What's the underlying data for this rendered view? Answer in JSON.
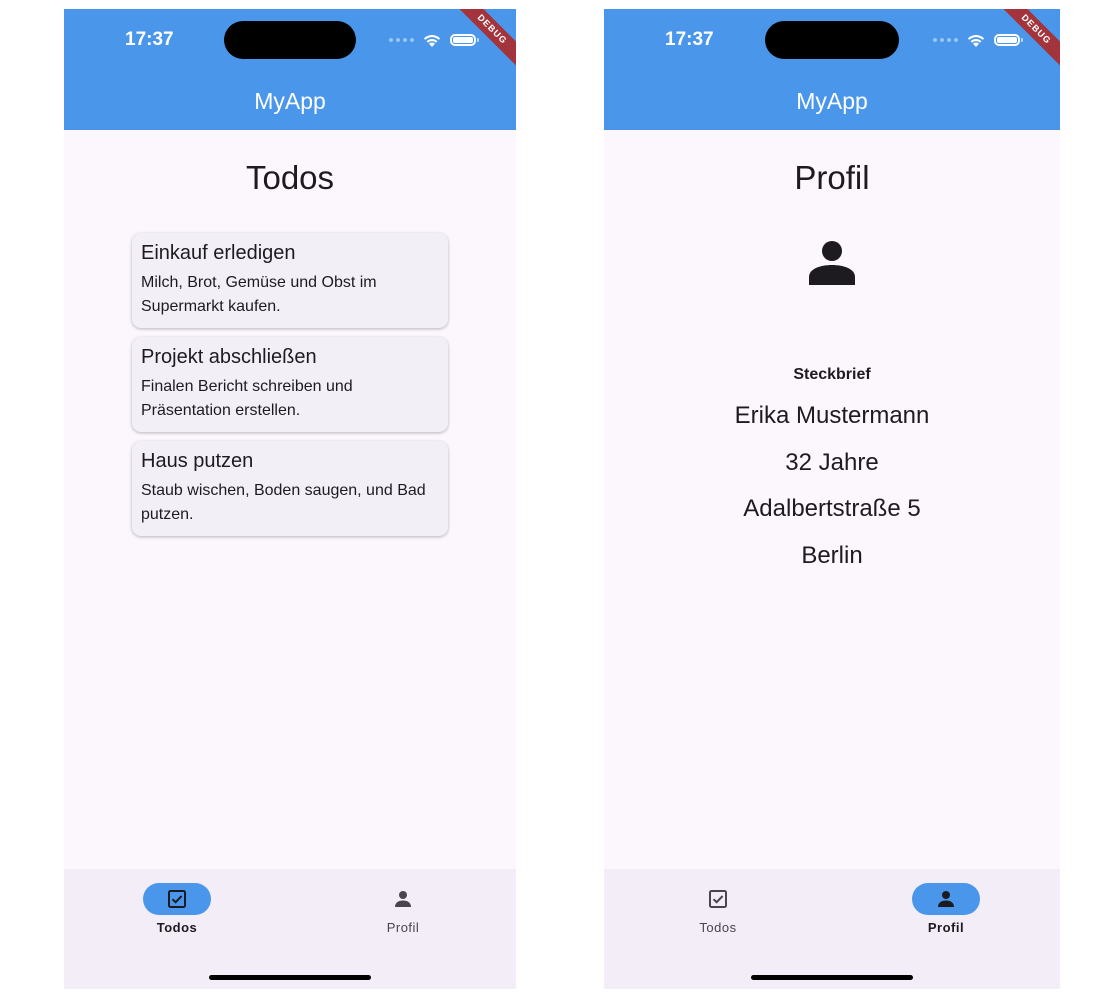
{
  "colors": {
    "appbar": "#4a96eb",
    "page_background": "#fcf7fd",
    "card_background": "#f3eff6",
    "bottom_nav_background": "#f2edf6",
    "nav_active_pill": "#4a96eb",
    "debug_banner": "#a3343c"
  },
  "screens": [
    {
      "status": {
        "time": "17:37"
      },
      "debug_banner": "DEBUG",
      "app_title": "MyApp",
      "heading": "Todos",
      "todos": [
        {
          "title": "Einkauf erledigen",
          "description": "Milch, Brot, Gemüse und Obst im Supermarkt kaufen."
        },
        {
          "title": "Projekt abschließen",
          "description": "Finalen Bericht schreiben und Präsentation erstellen."
        },
        {
          "title": "Haus putzen",
          "description": "Staub wischen, Boden saugen, und Bad putzen."
        }
      ],
      "nav": [
        {
          "label": "Todos",
          "icon": "check-box-icon",
          "active": true
        },
        {
          "label": "Profil",
          "icon": "person-icon",
          "active": false
        }
      ]
    },
    {
      "status": {
        "time": "17:37"
      },
      "debug_banner": "DEBUG",
      "app_title": "MyApp",
      "heading": "Profil",
      "profile": {
        "icon": "person-icon",
        "section_label": "Steckbrief",
        "name": "Erika Mustermann",
        "age": "32 Jahre",
        "street": "Adalbertstraße 5",
        "city": "Berlin"
      },
      "nav": [
        {
          "label": "Todos",
          "icon": "check-box-icon",
          "active": false
        },
        {
          "label": "Profil",
          "icon": "person-icon",
          "active": true
        }
      ]
    }
  ]
}
